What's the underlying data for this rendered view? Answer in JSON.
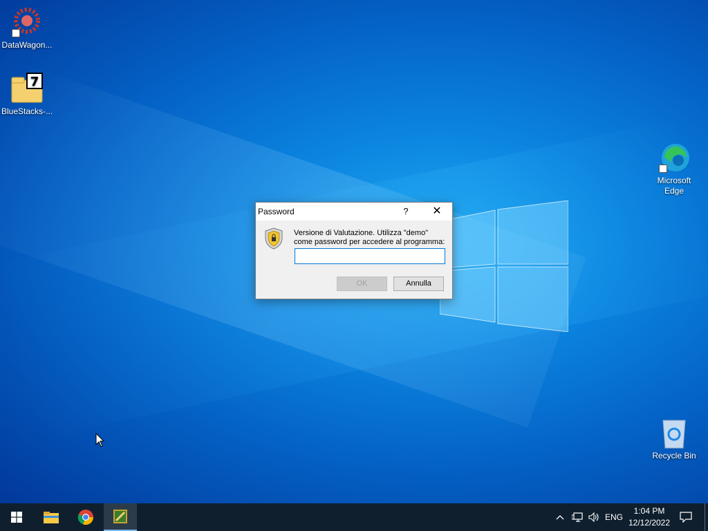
{
  "desktop": {
    "icons": [
      {
        "label": "DataWagon..."
      },
      {
        "label": "BlueStacks-..."
      },
      {
        "label": "Microsoft Edge"
      },
      {
        "label": "Recycle Bin"
      }
    ]
  },
  "dialog": {
    "title": "Password",
    "help_label": "?",
    "close_label": "✕",
    "message": "Versione di Valutazione. Utilizza \"demo\" come password per accedere al programma:",
    "password_value": "",
    "ok_label": "OK",
    "cancel_label": "Annulla"
  },
  "taskbar": {
    "tray_chevron": "^",
    "language": "ENG",
    "time": "1:04 PM",
    "date": "12/12/2022"
  },
  "colors": {
    "accent": "#0078d7",
    "taskbar": "#0f1f2e"
  }
}
